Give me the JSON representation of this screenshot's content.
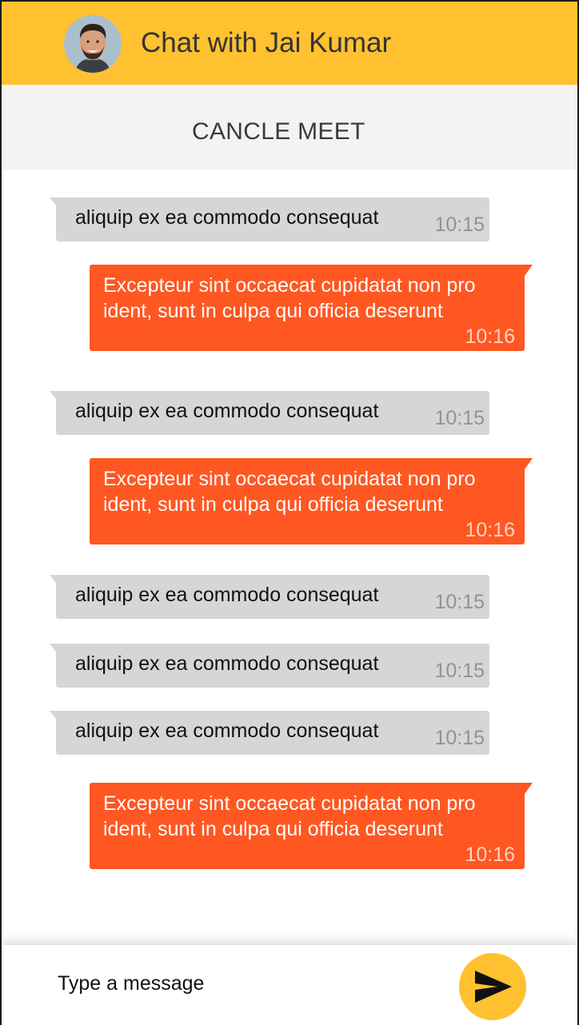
{
  "header": {
    "title": "Chat with Jai Kumar",
    "accent_color": "#ffc12f"
  },
  "actions": {
    "cancel_label": "CANCLE MEET"
  },
  "messages": [
    {
      "direction": "in",
      "text": "aliquip ex ea commodo consequat",
      "time": "10:15"
    },
    {
      "direction": "out",
      "text": "Excepteur sint occaecat cupidatat non pro\nident, sunt in culpa qui officia deserunt",
      "time": "10:16"
    },
    {
      "direction": "in",
      "text": "aliquip ex ea commodo consequat",
      "time": "10:15"
    },
    {
      "direction": "out",
      "text": "Excepteur sint occaecat cupidatat non pro\nident, sunt in culpa qui officia deserunt",
      "time": "10:16"
    },
    {
      "direction": "in",
      "text": "aliquip ex ea commodo consequat",
      "time": "10:15"
    },
    {
      "direction": "in",
      "text": "aliquip ex ea commodo consequat",
      "time": "10:15"
    },
    {
      "direction": "in",
      "text": "aliquip ex ea commodo consequat",
      "time": "10:15"
    },
    {
      "direction": "out",
      "text": "Excepteur sint occaecat cupidatat non pro\nident, sunt in culpa qui officia deserunt",
      "time": "10:16"
    }
  ],
  "composer": {
    "placeholder": "Type a message",
    "value": "",
    "send_icon": "send-icon"
  },
  "colors": {
    "incoming_bubble": "#d6d6d6",
    "outgoing_bubble": "#ff5722"
  }
}
